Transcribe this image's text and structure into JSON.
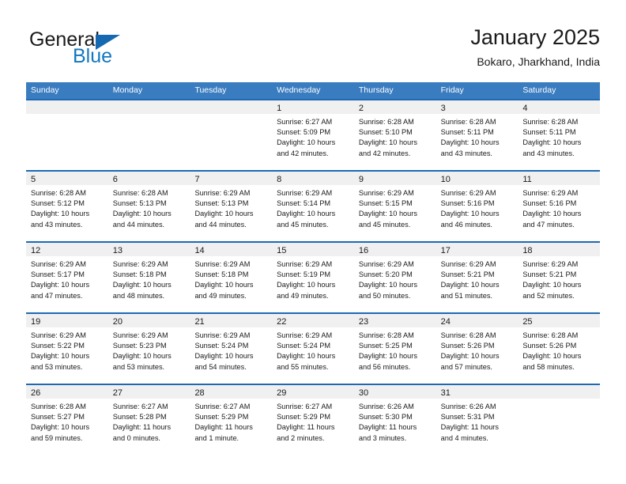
{
  "brand": {
    "name_part1": "General",
    "name_part2": "Blue",
    "logo_icon": "blue-triangle-icon",
    "accent_color": "#1278be",
    "triangle_color": "#1569b0"
  },
  "header": {
    "title": "January 2025",
    "subtitle": "Bokaro, Jharkhand, India"
  },
  "calendar": {
    "header_bg": "#3a7cc0",
    "cell_border_color": "#1f69b3",
    "daynum_bg": "#f0f0f0",
    "weekdays": [
      "Sunday",
      "Monday",
      "Tuesday",
      "Wednesday",
      "Thursday",
      "Friday",
      "Saturday"
    ],
    "weeks": [
      [
        {
          "day": "",
          "empty": true
        },
        {
          "day": "",
          "empty": true
        },
        {
          "day": "",
          "empty": true
        },
        {
          "day": "1",
          "sunrise": "Sunrise: 6:27 AM",
          "sunset": "Sunset: 5:09 PM",
          "daylight1": "Daylight: 10 hours",
          "daylight2": "and 42 minutes."
        },
        {
          "day": "2",
          "sunrise": "Sunrise: 6:28 AM",
          "sunset": "Sunset: 5:10 PM",
          "daylight1": "Daylight: 10 hours",
          "daylight2": "and 42 minutes."
        },
        {
          "day": "3",
          "sunrise": "Sunrise: 6:28 AM",
          "sunset": "Sunset: 5:11 PM",
          "daylight1": "Daylight: 10 hours",
          "daylight2": "and 43 minutes."
        },
        {
          "day": "4",
          "sunrise": "Sunrise: 6:28 AM",
          "sunset": "Sunset: 5:11 PM",
          "daylight1": "Daylight: 10 hours",
          "daylight2": "and 43 minutes."
        }
      ],
      [
        {
          "day": "5",
          "sunrise": "Sunrise: 6:28 AM",
          "sunset": "Sunset: 5:12 PM",
          "daylight1": "Daylight: 10 hours",
          "daylight2": "and 43 minutes."
        },
        {
          "day": "6",
          "sunrise": "Sunrise: 6:28 AM",
          "sunset": "Sunset: 5:13 PM",
          "daylight1": "Daylight: 10 hours",
          "daylight2": "and 44 minutes."
        },
        {
          "day": "7",
          "sunrise": "Sunrise: 6:29 AM",
          "sunset": "Sunset: 5:13 PM",
          "daylight1": "Daylight: 10 hours",
          "daylight2": "and 44 minutes."
        },
        {
          "day": "8",
          "sunrise": "Sunrise: 6:29 AM",
          "sunset": "Sunset: 5:14 PM",
          "daylight1": "Daylight: 10 hours",
          "daylight2": "and 45 minutes."
        },
        {
          "day": "9",
          "sunrise": "Sunrise: 6:29 AM",
          "sunset": "Sunset: 5:15 PM",
          "daylight1": "Daylight: 10 hours",
          "daylight2": "and 45 minutes."
        },
        {
          "day": "10",
          "sunrise": "Sunrise: 6:29 AM",
          "sunset": "Sunset: 5:16 PM",
          "daylight1": "Daylight: 10 hours",
          "daylight2": "and 46 minutes."
        },
        {
          "day": "11",
          "sunrise": "Sunrise: 6:29 AM",
          "sunset": "Sunset: 5:16 PM",
          "daylight1": "Daylight: 10 hours",
          "daylight2": "and 47 minutes."
        }
      ],
      [
        {
          "day": "12",
          "sunrise": "Sunrise: 6:29 AM",
          "sunset": "Sunset: 5:17 PM",
          "daylight1": "Daylight: 10 hours",
          "daylight2": "and 47 minutes."
        },
        {
          "day": "13",
          "sunrise": "Sunrise: 6:29 AM",
          "sunset": "Sunset: 5:18 PM",
          "daylight1": "Daylight: 10 hours",
          "daylight2": "and 48 minutes."
        },
        {
          "day": "14",
          "sunrise": "Sunrise: 6:29 AM",
          "sunset": "Sunset: 5:18 PM",
          "daylight1": "Daylight: 10 hours",
          "daylight2": "and 49 minutes."
        },
        {
          "day": "15",
          "sunrise": "Sunrise: 6:29 AM",
          "sunset": "Sunset: 5:19 PM",
          "daylight1": "Daylight: 10 hours",
          "daylight2": "and 49 minutes."
        },
        {
          "day": "16",
          "sunrise": "Sunrise: 6:29 AM",
          "sunset": "Sunset: 5:20 PM",
          "daylight1": "Daylight: 10 hours",
          "daylight2": "and 50 minutes."
        },
        {
          "day": "17",
          "sunrise": "Sunrise: 6:29 AM",
          "sunset": "Sunset: 5:21 PM",
          "daylight1": "Daylight: 10 hours",
          "daylight2": "and 51 minutes."
        },
        {
          "day": "18",
          "sunrise": "Sunrise: 6:29 AM",
          "sunset": "Sunset: 5:21 PM",
          "daylight1": "Daylight: 10 hours",
          "daylight2": "and 52 minutes."
        }
      ],
      [
        {
          "day": "19",
          "sunrise": "Sunrise: 6:29 AM",
          "sunset": "Sunset: 5:22 PM",
          "daylight1": "Daylight: 10 hours",
          "daylight2": "and 53 minutes."
        },
        {
          "day": "20",
          "sunrise": "Sunrise: 6:29 AM",
          "sunset": "Sunset: 5:23 PM",
          "daylight1": "Daylight: 10 hours",
          "daylight2": "and 53 minutes."
        },
        {
          "day": "21",
          "sunrise": "Sunrise: 6:29 AM",
          "sunset": "Sunset: 5:24 PM",
          "daylight1": "Daylight: 10 hours",
          "daylight2": "and 54 minutes."
        },
        {
          "day": "22",
          "sunrise": "Sunrise: 6:29 AM",
          "sunset": "Sunset: 5:24 PM",
          "daylight1": "Daylight: 10 hours",
          "daylight2": "and 55 minutes."
        },
        {
          "day": "23",
          "sunrise": "Sunrise: 6:28 AM",
          "sunset": "Sunset: 5:25 PM",
          "daylight1": "Daylight: 10 hours",
          "daylight2": "and 56 minutes."
        },
        {
          "day": "24",
          "sunrise": "Sunrise: 6:28 AM",
          "sunset": "Sunset: 5:26 PM",
          "daylight1": "Daylight: 10 hours",
          "daylight2": "and 57 minutes."
        },
        {
          "day": "25",
          "sunrise": "Sunrise: 6:28 AM",
          "sunset": "Sunset: 5:26 PM",
          "daylight1": "Daylight: 10 hours",
          "daylight2": "and 58 minutes."
        }
      ],
      [
        {
          "day": "26",
          "sunrise": "Sunrise: 6:28 AM",
          "sunset": "Sunset: 5:27 PM",
          "daylight1": "Daylight: 10 hours",
          "daylight2": "and 59 minutes."
        },
        {
          "day": "27",
          "sunrise": "Sunrise: 6:27 AM",
          "sunset": "Sunset: 5:28 PM",
          "daylight1": "Daylight: 11 hours",
          "daylight2": "and 0 minutes."
        },
        {
          "day": "28",
          "sunrise": "Sunrise: 6:27 AM",
          "sunset": "Sunset: 5:29 PM",
          "daylight1": "Daylight: 11 hours",
          "daylight2": "and 1 minute."
        },
        {
          "day": "29",
          "sunrise": "Sunrise: 6:27 AM",
          "sunset": "Sunset: 5:29 PM",
          "daylight1": "Daylight: 11 hours",
          "daylight2": "and 2 minutes."
        },
        {
          "day": "30",
          "sunrise": "Sunrise: 6:26 AM",
          "sunset": "Sunset: 5:30 PM",
          "daylight1": "Daylight: 11 hours",
          "daylight2": "and 3 minutes."
        },
        {
          "day": "31",
          "sunrise": "Sunrise: 6:26 AM",
          "sunset": "Sunset: 5:31 PM",
          "daylight1": "Daylight: 11 hours",
          "daylight2": "and 4 minutes."
        },
        {
          "day": "",
          "empty": true
        }
      ]
    ]
  }
}
